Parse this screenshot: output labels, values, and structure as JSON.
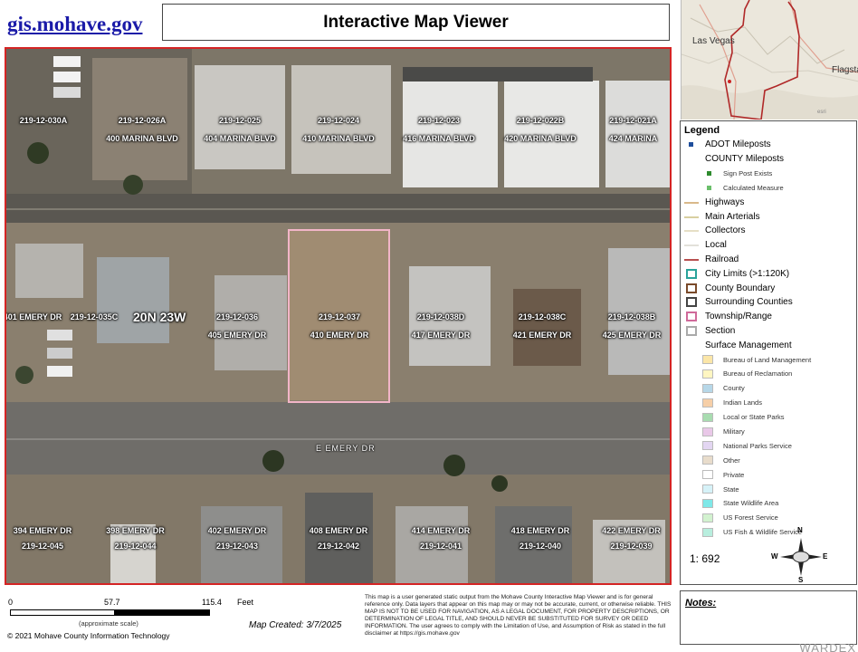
{
  "header": {
    "site_link": "gis.mohave.gov",
    "title": "Interactive Map Viewer"
  },
  "locator": {
    "cities": [
      "Las Vegas",
      "Flagsta"
    ],
    "credit": "esri"
  },
  "map": {
    "township": "20N 23W",
    "street": "E EMERY DR",
    "parcels_top": [
      {
        "pid": "219-12-030A",
        "addr": ""
      },
      {
        "pid": "219-12-026A",
        "addr": "400 MARINA BLVD"
      },
      {
        "pid": "219-12-025",
        "addr": "404 MARINA BLVD"
      },
      {
        "pid": "219-12-024",
        "addr": "410 MARINA BLVD"
      },
      {
        "pid": "219-12-023",
        "addr": "416 MARINA BLVD"
      },
      {
        "pid": "219-12-022B",
        "addr": "420 MARINA BLVD"
      },
      {
        "pid": "219-12-021A",
        "addr": "424 MARINA"
      }
    ],
    "parcels_middle": [
      {
        "pid": "",
        "addr": "401 EMERY DR"
      },
      {
        "pid": "219-12-035C",
        "addr": ""
      },
      {
        "pid": "219-12-036",
        "addr": "405 EMERY DR"
      },
      {
        "pid": "219-12-037",
        "addr": "410 EMERY DR"
      },
      {
        "pid": "219-12-038D",
        "addr": "417 EMERY DR"
      },
      {
        "pid": "219-12-038C",
        "addr": "421 EMERY DR"
      },
      {
        "pid": "219-12-038B",
        "addr": "425 EMERY DR"
      }
    ],
    "parcels_bottom": [
      {
        "addr": "394 EMERY DR",
        "pid": "219-12-045"
      },
      {
        "addr": "398 EMERY DR",
        "pid": "219-12-044"
      },
      {
        "addr": "402 EMERY DR",
        "pid": "219-12-043"
      },
      {
        "addr": "408 EMERY DR",
        "pid": "219-12-042"
      },
      {
        "addr": "414 EMERY DR",
        "pid": "219-12-041"
      },
      {
        "addr": "418 EMERY DR",
        "pid": "219-12-040"
      },
      {
        "addr": "422 EMERY DR",
        "pid": "219-12-039"
      }
    ]
  },
  "legend": {
    "title": "Legend",
    "items": [
      {
        "label": "ADOT Mileposts",
        "kind": "dot",
        "color": "#1f4e9c",
        "size": "normal"
      },
      {
        "label": "COUNTY Mileposts",
        "kind": "none",
        "color": "",
        "size": "normal"
      },
      {
        "label": "Sign Post Exists",
        "kind": "dot",
        "color": "#2e8b2e",
        "size": "small"
      },
      {
        "label": "Calculated Measure",
        "kind": "dot",
        "color": "#6bbf6b",
        "size": "small"
      },
      {
        "label": "Highways",
        "kind": "line",
        "color": "#d9b98a",
        "size": "normal"
      },
      {
        "label": "Main Arterials",
        "kind": "line",
        "color": "#d8cfa0",
        "size": "normal"
      },
      {
        "label": "Collectors",
        "kind": "line",
        "color": "#e6dfc6",
        "size": "normal"
      },
      {
        "label": "Local",
        "kind": "line",
        "color": "#e3e1da",
        "size": "normal"
      },
      {
        "label": "Railroad",
        "kind": "line",
        "color": "#b85050",
        "size": "normal"
      },
      {
        "label": "City Limits (>1:120K)",
        "kind": "box",
        "color": "#2aa39a",
        "size": "normal"
      },
      {
        "label": "County Boundary",
        "kind": "box",
        "color": "#7a4a2a",
        "size": "normal"
      },
      {
        "label": "Surrounding Counties",
        "kind": "box",
        "color": "#444444",
        "size": "normal"
      },
      {
        "label": "Township/Range",
        "kind": "box",
        "color": "#d06a9a",
        "size": "normal"
      },
      {
        "label": "Section",
        "kind": "box",
        "color": "#aaaaaa",
        "size": "normal"
      },
      {
        "label": "Surface Management",
        "kind": "none",
        "color": "",
        "size": "normal"
      },
      {
        "label": "Bureau of Land Management",
        "kind": "fill",
        "color": "#fbe6a8",
        "size": "small"
      },
      {
        "label": "Bureau of Reclamation",
        "kind": "fill",
        "color": "#fff6c2",
        "size": "small"
      },
      {
        "label": "County",
        "kind": "fill",
        "color": "#b6d7e8",
        "size": "small"
      },
      {
        "label": "Indian Lands",
        "kind": "fill",
        "color": "#f6cfa8",
        "size": "small"
      },
      {
        "label": "Local or State Parks",
        "kind": "fill",
        "color": "#a8dcb0",
        "size": "small"
      },
      {
        "label": "Military",
        "kind": "fill",
        "color": "#e9c8e8",
        "size": "small"
      },
      {
        "label": "National Parks Service",
        "kind": "fill",
        "color": "#e3d6f2",
        "size": "small"
      },
      {
        "label": "Other",
        "kind": "fill",
        "color": "#e8dccb",
        "size": "small"
      },
      {
        "label": "Private",
        "kind": "fill",
        "color": "#ffffff",
        "size": "small"
      },
      {
        "label": "State",
        "kind": "fill",
        "color": "#d6f2f8",
        "size": "small"
      },
      {
        "label": "State Wildlife Area",
        "kind": "fill",
        "color": "#7fe8e8",
        "size": "small"
      },
      {
        "label": "US Forest Service",
        "kind": "fill",
        "color": "#d2f2cf",
        "size": "small"
      },
      {
        "label": "US Fish & Wildlife Service",
        "kind": "fill",
        "color": "#b8eede",
        "size": "small"
      }
    ],
    "scale_ratio": "1: 692",
    "compass": [
      "N",
      "E",
      "S",
      "W"
    ]
  },
  "scalebar": {
    "ticks": [
      "0",
      "57.7",
      "115.4"
    ],
    "unit": "Feet",
    "note": "(approximate scale)"
  },
  "copyright": "© 2021 Mohave County Information Technology",
  "created": "Map Created: 3/7/2025",
  "disclaimer": "This map is a user generated static output from the Mohave County Interactive Map Viewer and is for general reference only. Data layers that appear on this map may or may not be accurate, current, or otherwise reliable. THIS MAP IS NOT TO BE USED FOR NAVIGATION, AS A LEGAL DOCUMENT, FOR PROPERTY DESCRIPTIONS, OR DETERMINATION OF LEGAL TITLE, AND SHOULD NEVER BE SUBSTITUTED FOR SURVEY OR DEED INFORMATION. The user agrees to comply with the Limitation of Use, and Assumption of Risk as stated in the full disclaimer at https://gis.mohave.gov",
  "notes_label": "Notes:",
  "watermark": "WARDEX"
}
